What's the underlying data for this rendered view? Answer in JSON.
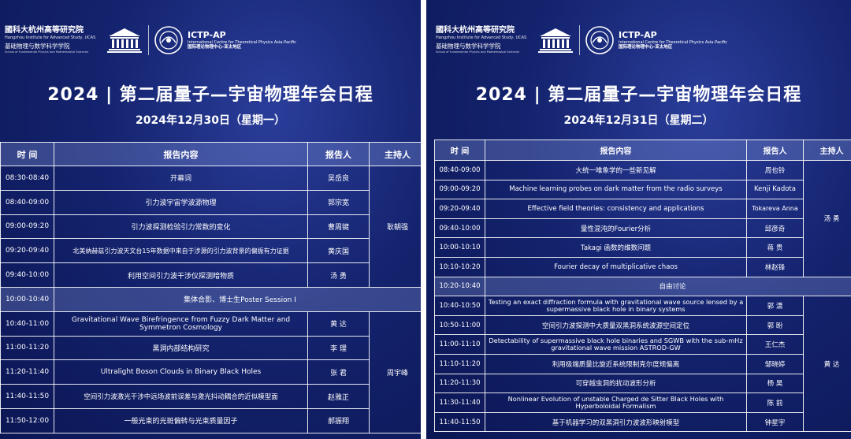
{
  "left": {
    "logos": {
      "hias_cn": "國科大杭州高等研究院",
      "hias_en": "Hangzhou Institute for Advanced Study, UCAS",
      "school_cn": "基础物理与数学科学学院",
      "school_en": "School of Fundamental Physics and Mathematical Sciences",
      "unesco": "UNESCO",
      "ictp": "ICTP-AP",
      "ictp_en": "International Centre for Theoretical Physics Asia-Pacific",
      "ictp_cn": "国际理论物理中心-亚太地区"
    },
    "title": "2024 | 第二届量子—宇宙物理年会日程",
    "date": "2024年12月30日（星期一）",
    "headers": {
      "time": "时 间",
      "content": "报告内容",
      "speaker": "报告人",
      "host": "主持人"
    },
    "rows": [
      {
        "time": "08:30-08:40",
        "content": "开幕词",
        "speaker": "吴岳良"
      },
      {
        "time": "08:40-09:00",
        "content": "引力波宇宙学波源物理",
        "speaker": "郭宗宽"
      },
      {
        "time": "09:00-09:20",
        "content": "引力波探测检验引力常数的变化",
        "speaker": "曹周键"
      },
      {
        "time": "09:20-09:40",
        "content": "北美纳赫兹引力波天文台15年数据中来自于涉源的引力波背景的偏振有力证据",
        "speaker": "黄庆国"
      },
      {
        "time": "09:40-10:00",
        "content": "利用空间引力波干涉仪探测暗物质",
        "speaker": "汤 勇"
      },
      {
        "time": "10:00-10:40",
        "content": "集体合影、博士生Poster Session I",
        "break": true
      },
      {
        "time": "10:40-11:00",
        "content": "Gravitational Wave Birefringence from Fuzzy Dark Matter and Symmetron Cosmology",
        "speaker": "黄 达"
      },
      {
        "time": "11:00-11:20",
        "content": "黑洞内部结构研究",
        "speaker": "李 理"
      },
      {
        "time": "11:20-11:40",
        "content": "Ultralight Boson Clouds in Binary Black Holes",
        "speaker": "张 君"
      },
      {
        "time": "11:40-11:50",
        "content": "空间引力波激光干涉中远场波前误差与激光抖动耦合的近似模型面",
        "speaker": "赵雅正"
      },
      {
        "time": "11:50-12:00",
        "content": "一般光束的光斑偏转与光束质量因子",
        "speaker": "郝振翔"
      }
    ],
    "hosts": [
      "耿朝强",
      "周宇峰"
    ]
  },
  "right": {
    "logos": {
      "hias_cn": "國科大杭州高等研究院",
      "hias_en": "Hangzhou Institute for Advanced Study, UCAS",
      "school_cn": "基础物理与数学科学学院",
      "school_en": "School of Fundamental Physics and Mathematical Sciences",
      "unesco": "UNESCO",
      "ictp": "ICTP-AP",
      "ictp_en": "International Centre for Theoretical Physics Asia-Pacific",
      "ictp_cn": "国际理论物理中心-亚太地区"
    },
    "title": "2024 | 第二届量子—宇宙物理年会日程",
    "date": "2024年12月31日（星期二）",
    "headers": {
      "time": "时 间",
      "content": "报告内容",
      "speaker": "报告人",
      "host": "主持人"
    },
    "rows": [
      {
        "time": "08:40-09:00",
        "content": "大统一唯象学的一些新见解",
        "speaker": "周也铃"
      },
      {
        "time": "09:00-09:20",
        "content": "Machine learning probes on dark matter from the radio surveys",
        "speaker": "Kenji Kadota"
      },
      {
        "time": "09:20-09:40",
        "content": "Effective field theories: consistency and applications",
        "speaker": "Tokareva Anna"
      },
      {
        "time": "09:40-10:00",
        "content": "量性混沌的Fourier分析",
        "speaker": "邱彦奇"
      },
      {
        "time": "10:00-10:10",
        "content": "Takagi 函数的维数问题",
        "speaker": "蒋 贵"
      },
      {
        "time": "10:10-10:20",
        "content": "Fourier decay of multiplicative chaos",
        "speaker": "林赵锋"
      },
      {
        "time": "10:20-10:40",
        "content": "自由讨论",
        "break": true
      },
      {
        "time": "10:40-10:50",
        "content": "Testing an exact diffraction formula with gravitational wave source lensed by a supermassive black hole in binary systems",
        "speaker": "郭 潇"
      },
      {
        "time": "10:50-11:00",
        "content": "空间引力波探测中大质量双黑洞系统波源空间定位",
        "speaker": "郭 盼"
      },
      {
        "time": "11:00-11:10",
        "content": "Detectability of supermassive black hole binaries and SGWB with the sub-mHz gravitational wave mission ASTROD-GW",
        "speaker": "王仁杰"
      },
      {
        "time": "11:10-11:20",
        "content": "利用极端质量比旋近系统限制克尔度规偏离",
        "speaker": "邹晓婷"
      },
      {
        "time": "11:20-11:30",
        "content": "可穿越虫洞的扰动波形分析",
        "speaker": "杨 昊"
      },
      {
        "time": "11:30-11:40",
        "content": "Nonlinear Evolution of unstable Charged de Sitter Black Holes with Hyperboloidal Formalism",
        "speaker": "陈 前"
      },
      {
        "time": "11:40-11:50",
        "content": "基于机器学习的双黑洞引力波波形映射模型",
        "speaker": "钟星宇"
      }
    ],
    "hosts": [
      "汤 勇",
      "黄 达"
    ]
  }
}
